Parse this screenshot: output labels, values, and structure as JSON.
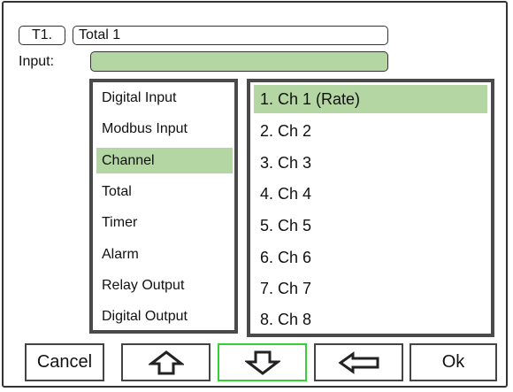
{
  "header": {
    "tag_label": "T1.",
    "name_value": "Total 1"
  },
  "input": {
    "label": "Input:",
    "value": ""
  },
  "sources": {
    "items": [
      "Digital Input",
      "Modbus Input",
      "Channel",
      "Total",
      "Timer",
      "Alarm",
      "Relay Output",
      "Digital Output"
    ],
    "selected": "Channel"
  },
  "channels": {
    "items": [
      "1. Ch 1 (Rate)",
      "2. Ch 2",
      "3. Ch 3",
      "4. Ch 4",
      "5. Ch 5",
      "6. Ch 6",
      "7. Ch 7",
      "8. Ch 8"
    ],
    "selected": "1. Ch 1 (Rate)"
  },
  "buttons": {
    "cancel_label": "Cancel",
    "up_icon": "arrow-up-outline-icon",
    "down_icon": "arrow-down-outline-icon",
    "back_icon": "arrow-left-outline-icon",
    "ok_label": "Ok",
    "focused": "down"
  },
  "colors": {
    "selection": "#b4d6a2",
    "focus_border": "#35d235",
    "frame": "#333333"
  }
}
